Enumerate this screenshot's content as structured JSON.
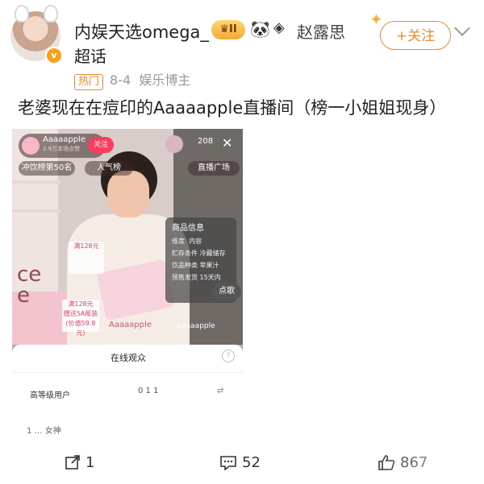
{
  "post": {
    "username": "内娱天选omega_",
    "badge_level": "II",
    "source_name": "赵露思",
    "supertopic": "超话",
    "follow_label": "+关注",
    "tag": "热门",
    "date": "8-4",
    "author_type": "娱乐博主",
    "text": "老婆现在在痘印的Aaaaapple直播间（榜一小姐姐现身）"
  },
  "live": {
    "channel_name": "Aaaaapple",
    "channel_sub": "2.9万本场点赞",
    "follow_label": "关注",
    "viewer_count": "208",
    "rank_label": "冲饮榜第50名",
    "popularity_label": "人气榜",
    "plaza_label": "直播广场",
    "product_title": "商品信息",
    "product_rows": [
      {
        "k": "维度",
        "v": "内容"
      },
      {
        "k": "贮存条件",
        "v": "冷藏储存"
      },
      {
        "k": "饮品种类",
        "v": "苹果汁"
      },
      {
        "k": "预售发货",
        "v": "15天内"
      }
    ],
    "snap_label": "点歌",
    "price_tag_1": "满128元",
    "price_tag_2_line1": "满128元",
    "price_tag_2_line2": "赠送5A瓶装",
    "price_tag_2_line3": "(价值59.8元)",
    "brand_text": "Aaaaapple",
    "box_text_1": "ce",
    "box_text_2": "e",
    "sheet_title": "在线观众",
    "sheet_label": "高等级用户",
    "sheet_counts": "0  1  1",
    "sheet_row_text": "1  …  女神"
  },
  "actions": {
    "repost_count": "1",
    "comment_count": "52",
    "like_count": "867"
  }
}
